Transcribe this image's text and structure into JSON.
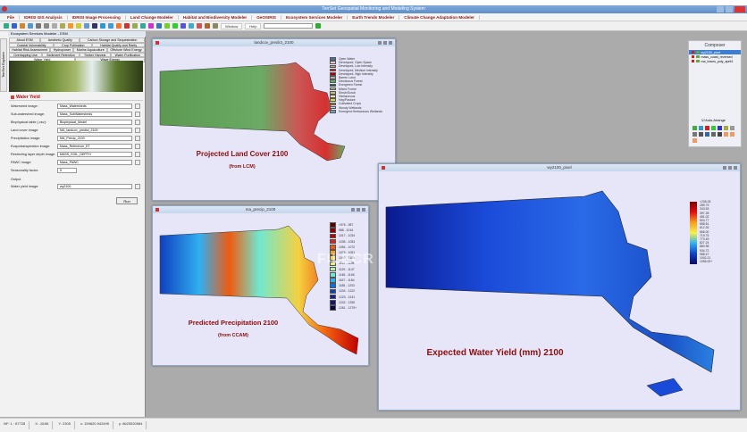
{
  "app": {
    "title": "TerrSet Geospatial Monitoring and Modeling System"
  },
  "menu": [
    "File",
    "IDRISI GIS Analysis",
    "IDRISI Image Processing",
    "Land Change Modeler",
    "Habitat and Biodiversity Modeler",
    "GeOSIRIS",
    "Ecosystem Services Modeler",
    "Earth Trends Modeler",
    "Climate Change Adaptation Modeler"
  ],
  "toolbar": {
    "window": "Window",
    "help": "Help"
  },
  "left_panel": {
    "side_tab": "TerrSet Explorer",
    "title": "Ecosystem Services Modeler - ESM",
    "tabs": [
      "About ESM",
      "Aesthetic Quality",
      "Carbon Storage and Sequestration",
      "Coastal Vulnerability",
      "Crop Pollination",
      "Habitat Quality and Rarity",
      "Habitat Risk Assessment",
      "Hydropower",
      "Marine Aquaculture",
      "Offshore Wind Energy",
      "Overlapping Use",
      "Sediment Retention",
      "Timber Harvest",
      "Water Purification",
      "Water Yield",
      "Wave Energy"
    ],
    "active_tab": "Water Yield",
    "section": "Water Yield",
    "fields": [
      {
        "label": "Watershed image:",
        "value": "Mass_Watersheds"
      },
      {
        "label": "Sub-watershed image:",
        "value": "Mass_SubWatersheds"
      },
      {
        "label": "Biophysical table (.csv):",
        "value": "Biophysical_Model"
      },
      {
        "label": "Land cover image:",
        "value": "MA_landcov_predict_2100"
      },
      {
        "label": "Precipitation image:",
        "value": "MA_Precip_2100"
      },
      {
        "label": "Evapotranspiration image:",
        "value": "Mass_Reference_ET"
      },
      {
        "label": "Restricting layer depth image:",
        "value": "MASS_SOIL_DEPTH"
      },
      {
        "label": "PAWC image:",
        "value": "Mass_PAWC"
      },
      {
        "label": "Seasonality factor:",
        "value": "5"
      }
    ],
    "output_label": "Output",
    "output_field": {
      "label": "Water yield image:",
      "value": "wy2100"
    },
    "run": "Run"
  },
  "windows": {
    "landcover": {
      "title": "landcov_predict_2100",
      "map_title": "Projected Land Cover 2100",
      "subtitle": "(from LCM)",
      "legend": [
        [
          "Open Water",
          "#4a6fa5"
        ],
        [
          "Developed, Open Space",
          "#e8c8c8"
        ],
        [
          "Developed, Low Intensity",
          "#d9967a"
        ],
        [
          "Developed, Medium Intensity",
          "#e01010"
        ],
        [
          "Developed, High Intensity",
          "#aa0000"
        ],
        [
          "Barren Land",
          "#b3aea3"
        ],
        [
          "Deciduous Forest",
          "#6aaa64"
        ],
        [
          "Evergreen Forest",
          "#1e6a2a"
        ],
        [
          "Mixed Forest",
          "#b5c98e"
        ],
        [
          "Shrub/Scrub",
          "#ccb879"
        ],
        [
          "Herbaceous",
          "#e3e3c2"
        ],
        [
          "Hay/Pasture",
          "#dcd93d"
        ],
        [
          "Cultivated Crops",
          "#ab7028"
        ],
        [
          "Woody Wetlands",
          "#b8d9eb"
        ],
        [
          "Emergent Herbaceous Wetlands",
          "#6c9fb8"
        ]
      ]
    },
    "precip": {
      "title": "ma_precip_2100",
      "map_title": "Predicted Precipitation 2100",
      "subtitle": "(from CCAM)",
      "legend": [
        "<976 - 987",
        "988 - 1016",
        "1017 - 1034",
        "1035 - 1053",
        "1054 - 1072",
        "1073 - 1091",
        "1092 - 1109",
        "1110 - 1128",
        "1129 - 1147",
        "1148 - 1166",
        "1167 - 1184",
        "1185 - 1203",
        "1204 - 1222",
        "1223 - 1241",
        "1242 - 1260",
        "1261 - 1279+"
      ],
      "colors": [
        "#5a0000",
        "#8b0000",
        "#c00000",
        "#e02010",
        "#f05a10",
        "#f5a020",
        "#f5d040",
        "#e6f070",
        "#b0f0a0",
        "#70e8d0",
        "#30b0f0",
        "#1070e0",
        "#1040c0",
        "#102090",
        "#101870",
        "#080840"
      ]
    },
    "wateryield": {
      "title": "wy2100_pixel",
      "map_title": "Expected Water Yield (mm) 2100",
      "legend": [
        "<236.05",
        "289.79",
        "343.53",
        "397.28",
        "451.02",
        "504.77",
        "558.51",
        "612.26",
        "666.00",
        "719.75",
        "773.49",
        "827.24",
        "880.98",
        "934.72",
        "988.47",
        "1042.21",
        "1096.00+"
      ]
    }
  },
  "composer": {
    "title": "Composer",
    "layers": [
      "wy2100_pixel",
      "mass_coast_reversed",
      "ma_towns_poly_aprit1"
    ],
    "auto_arrange": "Auto-Arrange"
  },
  "watermark": "FILECR",
  "status": [
    "NF: 1 : 87728",
    "X: -8196",
    "Y: 2305",
    "x: 159820.942495",
    "y: 8625520984"
  ]
}
